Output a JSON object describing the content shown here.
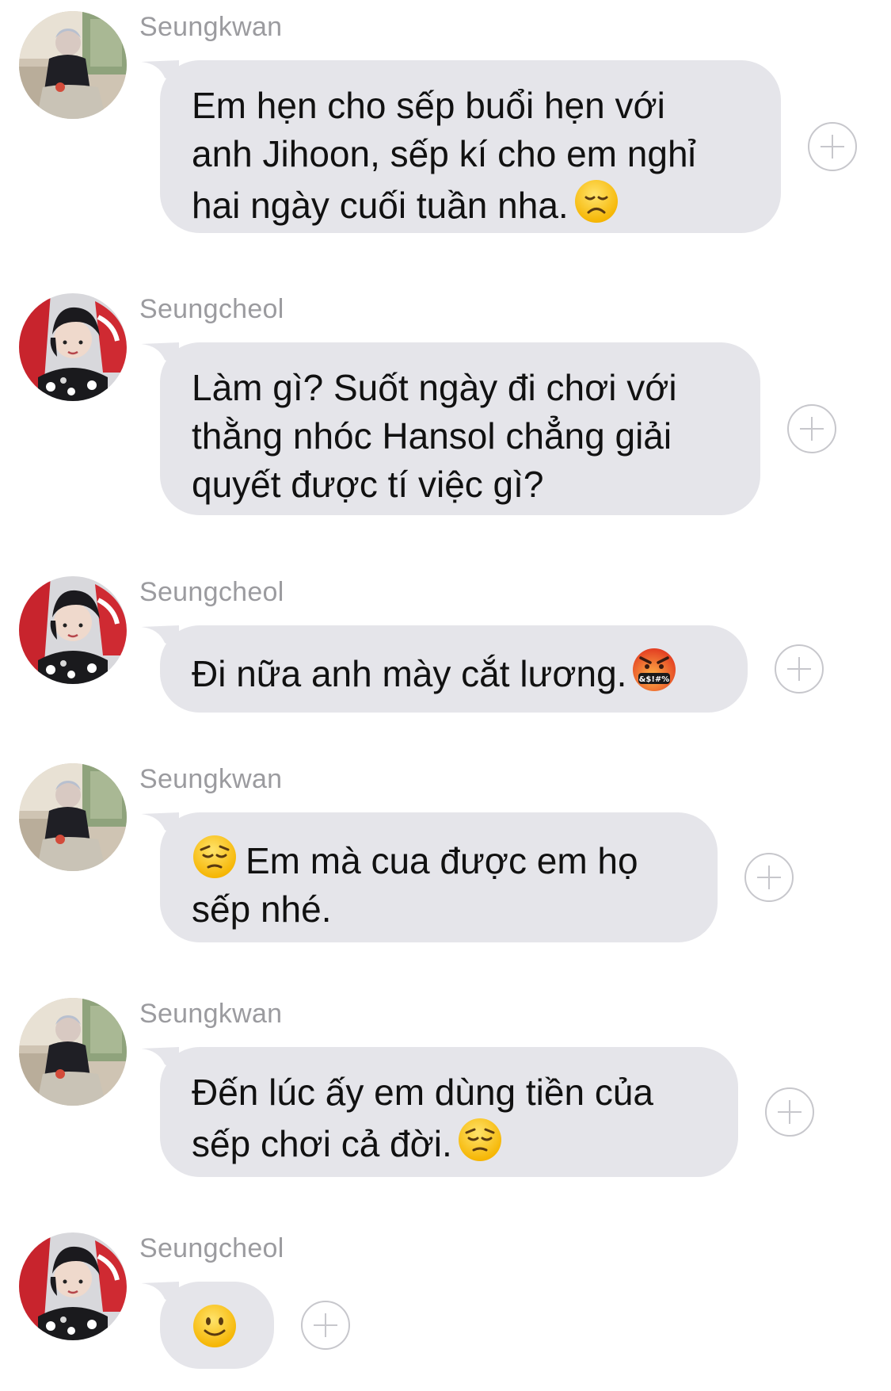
{
  "messages": [
    {
      "sender": "Seungkwan",
      "avatar": "seungkwan-avatar",
      "lines": [
        "Em hẹn cho sếp buổi hẹn với",
        "anh Jihoon, sếp kí cho em nghỉ",
        "hai ngày cuối tuần nha."
      ],
      "emoji": "disappointed-face-emoji"
    },
    {
      "sender": "Seungcheol",
      "avatar": "seungcheol-avatar",
      "lines": [
        "Làm gì? Suốt ngày đi chơi với",
        "thằng nhóc Hansol chẳng giải",
        "quyết được tí việc gì?"
      ]
    },
    {
      "sender": "Seungcheol",
      "avatar": "seungcheol-avatar",
      "lines": [
        "Đi nữa anh mày cắt lương."
      ],
      "emoji": "cursing-face-emoji"
    },
    {
      "sender": "Seungkwan",
      "avatar": "seungkwan-avatar",
      "lines": [
        "Em mà cua được em họ",
        "sếp nhé."
      ],
      "emoji": "pensive-face-emoji"
    },
    {
      "sender": "Seungkwan",
      "avatar": "seungkwan-avatar",
      "lines": [
        "Đến lúc ấy em dùng tiền của",
        "sếp chơi cả đời."
      ],
      "emoji": "pensive-face-emoji"
    },
    {
      "sender": "Seungcheol",
      "avatar": "seungcheol-avatar",
      "lines": [],
      "emoji": "slightly-smiling-face-emoji"
    }
  ],
  "colors": {
    "bubble": "#e5e5ea",
    "sender_name": "#9b9b9f",
    "message_text": "#111111",
    "plus_icon": "#c7c7cc"
  }
}
